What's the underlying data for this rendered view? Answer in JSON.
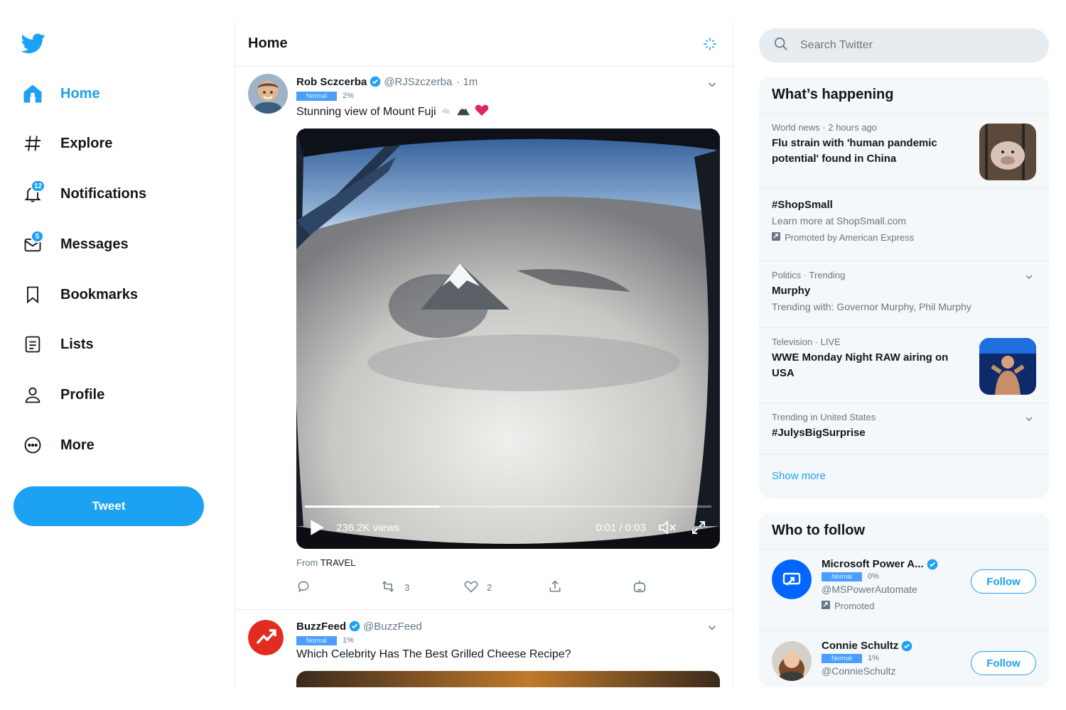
{
  "colors": {
    "accent": "#1da1f2",
    "background": "#ffffff",
    "panel": "#f5f8fa",
    "text": "#14171a",
    "muted": "#657786"
  },
  "sidebar": {
    "logo_icon": "twitter-bird-icon",
    "items": [
      {
        "label": "Home",
        "icon": "home-icon",
        "active": true
      },
      {
        "label": "Explore",
        "icon": "hashtag-icon"
      },
      {
        "label": "Notifications",
        "icon": "bell-icon",
        "badge": "12"
      },
      {
        "label": "Messages",
        "icon": "envelope-icon",
        "badge": "5"
      },
      {
        "label": "Bookmarks",
        "icon": "bookmark-icon"
      },
      {
        "label": "Lists",
        "icon": "list-icon"
      },
      {
        "label": "Profile",
        "icon": "person-icon"
      },
      {
        "label": "More",
        "icon": "more-icon"
      }
    ],
    "tweet_button": "Tweet"
  },
  "main": {
    "title": "Home",
    "tweets": [
      {
        "name": "Rob Sczcerba",
        "handle": "@RJSzczerba",
        "time": "· 1m",
        "tag": "Normal",
        "percent": "2%",
        "text": "Stunning view of Mount Fuji",
        "media": {
          "views": "236.2K views",
          "time": "0:01 / 0:03",
          "progress": 0.33
        },
        "source_prefix": "From",
        "source": "TRAVEL",
        "stats": {
          "retweets": "3",
          "likes": "2"
        }
      },
      {
        "name": "BuzzFeed",
        "handle": "@BuzzFeed",
        "tag": "Normal",
        "percent": "1%",
        "text": "Which Celebrity Has The Best Grilled Cheese Recipe?"
      }
    ]
  },
  "search": {
    "placeholder": "Search Twitter"
  },
  "trends": {
    "title": "What’s happening",
    "items": [
      {
        "meta": "World news · 2 hours ago",
        "title": "Flu strain with 'human pandemic potential' found in China"
      },
      {
        "title": "#ShopSmall",
        "sub": "Learn more at ShopSmall.com",
        "promo": "Promoted by American Express"
      },
      {
        "meta": "Politics · Trending",
        "title": "Murphy",
        "sub": "Trending with: Governor Murphy, Phil Murphy"
      },
      {
        "meta": "Television · LIVE",
        "title": "WWE Monday Night RAW airing on USA"
      },
      {
        "meta": "Trending in United States",
        "title": "#JulysBigSurprise"
      }
    ],
    "show_more": "Show more"
  },
  "who_to_follow": {
    "title": "Who to follow",
    "accounts": [
      {
        "name": "Microsoft Power A...",
        "tag": "Normal",
        "percent": "0%",
        "handle": "@MSPowerAutomate",
        "promo": "Promoted",
        "button": "Follow"
      },
      {
        "name": "Connie Schultz",
        "tag": "Normal",
        "percent": "1%",
        "handle": "@ConnieSchultz",
        "button": "Follow"
      }
    ]
  }
}
